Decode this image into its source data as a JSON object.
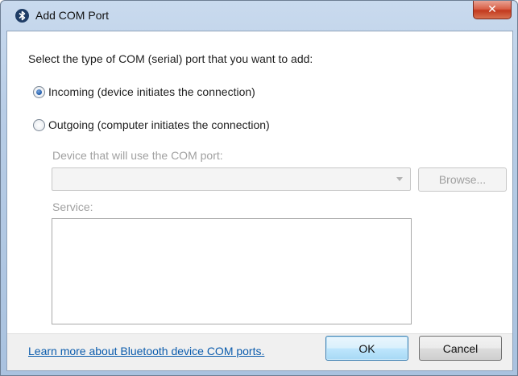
{
  "window": {
    "title": "Add COM Port",
    "close_glyph": "✕",
    "title_icon": "bluetooth-icon"
  },
  "dialog": {
    "prompt": "Select the type of COM (serial) port that you want to add:",
    "options": [
      {
        "label": "Incoming (device initiates the connection)",
        "selected": true
      },
      {
        "label": "Outgoing (computer initiates the connection)",
        "selected": false
      }
    ],
    "device_label": "Device that will use the COM port:",
    "device_value": "",
    "browse_label": "Browse...",
    "service_label": "Service:",
    "service_items": []
  },
  "footer": {
    "link_text": "Learn more about Bluetooth device COM ports.",
    "ok_label": "OK",
    "cancel_label": "Cancel"
  },
  "colors": {
    "link": "#0b5cad",
    "disabled_text": "#a0a0a0",
    "ok_border": "#3c7fb1"
  }
}
